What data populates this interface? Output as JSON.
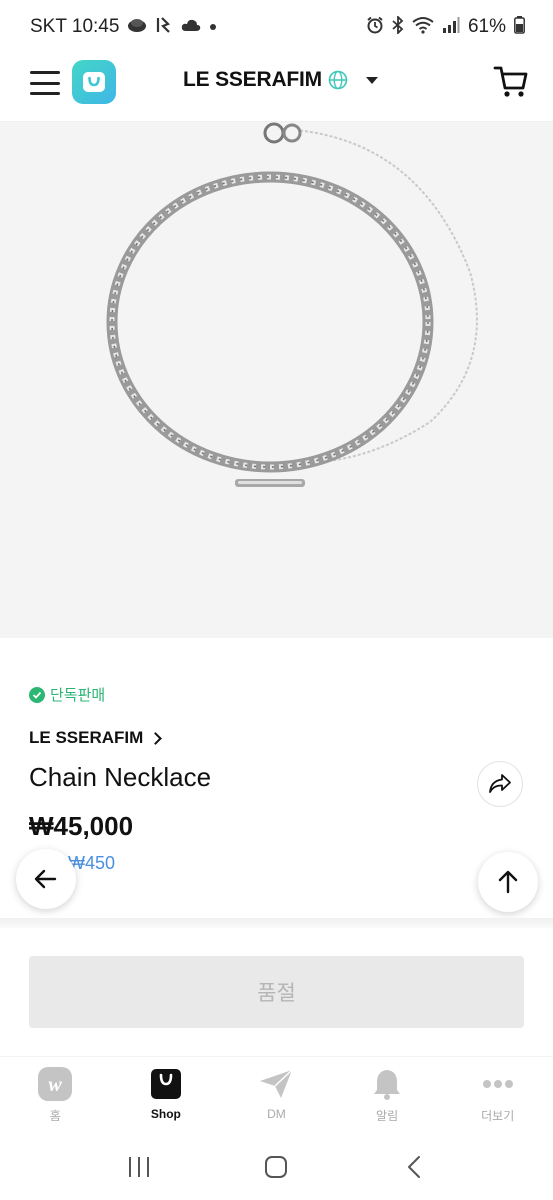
{
  "status_bar": {
    "carrier_time": "SKT 10:45",
    "battery": "61%"
  },
  "header": {
    "artist_name": "LE SSERAFIM",
    "icons": [
      "menu-icon",
      "app-logo",
      "globe-icon",
      "caret-down-icon",
      "cart-icon"
    ]
  },
  "product": {
    "exclusive_label": "단독판매",
    "brand": "LE SSERAFIM",
    "name": "Chain Necklace",
    "price": "₩45,000",
    "points": "₩450"
  },
  "actions": {
    "soldout_label": "품절"
  },
  "bottom_nav": {
    "items": [
      {
        "label": "홈",
        "icon": "weverse-home-icon"
      },
      {
        "label": "Shop",
        "icon": "shop-bag-icon"
      },
      {
        "label": "DM",
        "icon": "paper-plane-icon"
      },
      {
        "label": "알림",
        "icon": "bell-icon"
      },
      {
        "label": "더보기",
        "icon": "more-dots-icon"
      }
    ],
    "active_index": 1
  },
  "colors": {
    "accent_green": "#2bb673",
    "points_blue": "#4a8fe0",
    "logo_teal": "#43d7c7",
    "soldout_bg": "#e9e9e9"
  }
}
